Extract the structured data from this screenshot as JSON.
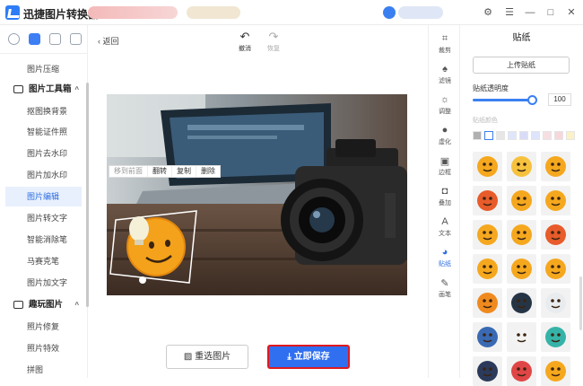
{
  "window": {
    "title": "迅捷图片转换器"
  },
  "window_controls": {
    "settings": "⚙",
    "menu": "☰",
    "minimize": "—",
    "maximize": "□",
    "close": "✕"
  },
  "sidebar": {
    "items": [
      {
        "label": "图片压缩",
        "selected": false
      },
      {
        "label": "抠图换背景",
        "selected": false
      },
      {
        "label": "智能证件照",
        "selected": false
      },
      {
        "label": "图片去水印",
        "selected": false
      },
      {
        "label": "图片加水印",
        "selected": false
      },
      {
        "label": "图片编辑",
        "selected": true
      },
      {
        "label": "图片转文字",
        "selected": false
      },
      {
        "label": "智能消除笔",
        "selected": false
      },
      {
        "label": "马赛克笔",
        "selected": false
      },
      {
        "label": "图片加文字",
        "selected": false
      },
      {
        "label": "照片修复",
        "selected": false
      },
      {
        "label": "照片特效",
        "selected": false
      },
      {
        "label": "拼图",
        "selected": false
      }
    ],
    "groups": [
      {
        "label": "图片工具箱",
        "caret": "^"
      },
      {
        "label": "趣玩图片",
        "caret": "^"
      }
    ]
  },
  "editor": {
    "back_label": "返回",
    "undo_label": "撤消",
    "redo_label": "恢复",
    "context_menu": [
      "移到前面",
      "翻转",
      "复制",
      "删除"
    ],
    "reselect_label": "重选图片",
    "save_label": "立即保存"
  },
  "tools": [
    {
      "label": "裁剪",
      "glyph": "⌗",
      "active": false
    },
    {
      "label": "滤镜",
      "glyph": "♠",
      "active": false
    },
    {
      "label": "调整",
      "glyph": "☼",
      "active": false
    },
    {
      "label": "虚化",
      "glyph": "●",
      "active": false
    },
    {
      "label": "边框",
      "glyph": "▣",
      "active": false
    },
    {
      "label": "叠加",
      "glyph": "◘",
      "active": false
    },
    {
      "label": "文本",
      "glyph": "A",
      "active": false
    },
    {
      "label": "贴纸",
      "glyph": "◕",
      "active": true
    },
    {
      "label": "画笔",
      "glyph": "✎",
      "active": false
    }
  ],
  "panel": {
    "title": "贴纸",
    "upload_label": "上传贴纸",
    "opacity_label": "贴纸透明度",
    "opacity_value": "100",
    "opacity_fraction": 0.9,
    "color_label": "贴纸颜色",
    "swatches": [
      "#b0b0b0",
      "#ffffff",
      "#e6e6e6",
      "#dfe6fb",
      "#d8dcf7",
      "#dde4fb",
      "#f6dfe3",
      "#f8d7dc",
      "#fbf0c6"
    ],
    "stickers": [
      {
        "icon": "face-fire-icon",
        "color": "#f5a81e"
      },
      {
        "icon": "face-cloud-icon",
        "color": "#f6c23e"
      },
      {
        "icon": "face-wink-icon",
        "color": "#f5a81e"
      },
      {
        "icon": "face-red-cheeks-icon",
        "color": "#e85b2a"
      },
      {
        "icon": "face-beer-icon",
        "color": "#f5a81e"
      },
      {
        "icon": "face-hug-icon",
        "color": "#f5a81e"
      },
      {
        "icon": "face-headphones-icon",
        "color": "#f5a81e"
      },
      {
        "icon": "face-money-icon",
        "color": "#f5a81e"
      },
      {
        "icon": "face-angry-icon",
        "color": "#e85b2a"
      },
      {
        "icon": "face-smile-icon",
        "color": "#f5a81e"
      },
      {
        "icon": "face-sunglasses-icon",
        "color": "#f5a81e"
      },
      {
        "icon": "face-nerd-icon",
        "color": "#f5a81e"
      },
      {
        "icon": "face-pumpkin-icon",
        "color": "#f08a1e"
      },
      {
        "icon": "face-cat-icon",
        "color": "#263545"
      },
      {
        "icon": "face-skull-icon",
        "color": "#e9ecef"
      },
      {
        "icon": "face-ninja-icon",
        "color": "#3a6ab3"
      },
      {
        "icon": "face-mask-icon",
        "color": "#f3f3f3"
      },
      {
        "icon": "face-alien-icon",
        "color": "#36b3a8"
      },
      {
        "icon": "face-robber-icon",
        "color": "#2b3a5a"
      },
      {
        "icon": "face-devil-icon",
        "color": "#e04646"
      },
      {
        "icon": "face-star-icon",
        "color": "#f5a81e"
      }
    ]
  }
}
